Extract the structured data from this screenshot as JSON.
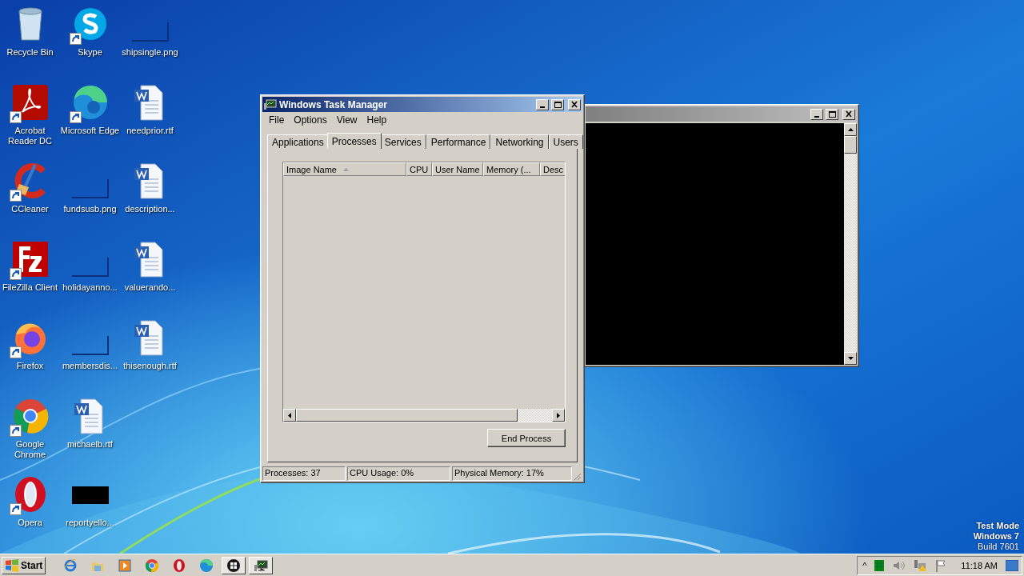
{
  "desktop_icons": [
    {
      "label": "Recycle Bin",
      "kind": "bin",
      "shortcut": false
    },
    {
      "label": "Acrobat Reader DC",
      "kind": "pdf",
      "shortcut": true
    },
    {
      "label": "CCleaner",
      "kind": "ccleaner",
      "shortcut": true
    },
    {
      "label": "FileZilla Client",
      "kind": "filezilla",
      "shortcut": true
    },
    {
      "label": "Firefox",
      "kind": "firefox",
      "shortcut": true
    },
    {
      "label": "Google Chrome",
      "kind": "chrome",
      "shortcut": true
    },
    {
      "label": "Opera",
      "kind": "opera",
      "shortcut": true
    },
    {
      "label": "Skype",
      "kind": "skype",
      "shortcut": true
    },
    {
      "label": "Microsoft Edge",
      "kind": "edge",
      "shortcut": true
    },
    {
      "label": "fundsusb.png",
      "kind": "blank",
      "shortcut": false
    },
    {
      "label": "holidayanno...",
      "kind": "blank",
      "shortcut": false
    },
    {
      "label": "membersdis...",
      "kind": "blank",
      "shortcut": false
    },
    {
      "label": "michaelb.rtf",
      "kind": "word",
      "shortcut": false
    },
    {
      "label": "reportyello...",
      "kind": "black",
      "shortcut": false
    },
    {
      "label": "shipsingle.png",
      "kind": "blank",
      "shortcut": false
    },
    {
      "label": "needprior.rtf",
      "kind": "word",
      "shortcut": false
    },
    {
      "label": "description...",
      "kind": "word",
      "shortcut": false
    },
    {
      "label": "valuerando...",
      "kind": "word",
      "shortcut": false
    },
    {
      "label": "thisenough.rtf",
      "kind": "word",
      "shortcut": false
    }
  ],
  "task_manager": {
    "title": "Windows Task Manager",
    "menu": [
      "File",
      "Options",
      "View",
      "Help"
    ],
    "tabs": [
      {
        "label": "Applications",
        "selected": false
      },
      {
        "label": "Processes",
        "selected": true
      },
      {
        "label": "Services",
        "selected": false
      },
      {
        "label": "Performance",
        "selected": false
      },
      {
        "label": "Networking",
        "selected": false
      },
      {
        "label": "Users",
        "selected": false
      }
    ],
    "columns": [
      {
        "label": "Image Name",
        "sorted": true
      },
      {
        "label": "CPU",
        "sorted": false
      },
      {
        "label": "User Name",
        "sorted": false
      },
      {
        "label": "Memory (...",
        "sorted": false
      },
      {
        "label": "Desc",
        "sorted": false
      }
    ],
    "button": "End Process",
    "status_bar": [
      "Processes: 37",
      "CPU Usage: 0%",
      "Physical Memory: 17%"
    ]
  },
  "watermark_lines": [
    "Test Mode",
    "Windows 7",
    "Build 7601"
  ],
  "taskbar": {
    "start": "Start",
    "items": [
      {
        "kind": "ie",
        "open": false
      },
      {
        "kind": "folder",
        "open": false
      },
      {
        "kind": "player",
        "open": false
      },
      {
        "kind": "chrome",
        "open": false
      },
      {
        "kind": "opera",
        "open": false
      },
      {
        "kind": "edge",
        "open": false
      },
      {
        "kind": "winlogo",
        "open": true
      },
      {
        "kind": "monitor",
        "open": true
      }
    ],
    "tray_arrow": "^",
    "clock": "11:18 AM"
  }
}
